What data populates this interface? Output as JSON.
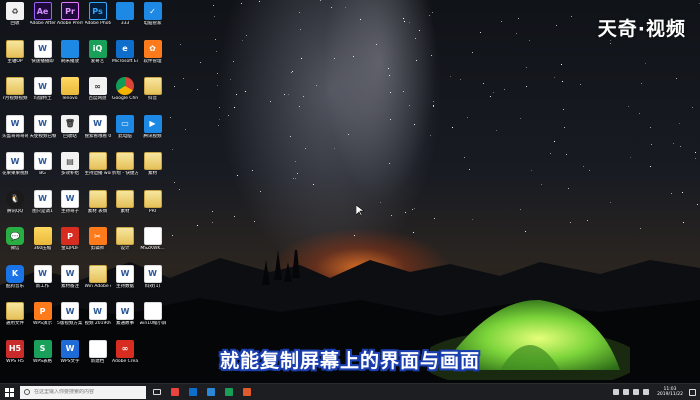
{
  "watermark": "天奇·视频",
  "subtitle": "就能复制屏幕上的界面与画面",
  "desktop_icons": [
    {
      "label": "回收",
      "icon": "recycle-bin-icon",
      "kind": "c-white",
      "glyph": "♻",
      "col": 0,
      "row": 0
    },
    {
      "label": "Adobe After Effects CC",
      "icon": "after-effects-icon",
      "kind": "c-ae",
      "glyph": "Ae",
      "col": 1,
      "row": 0
    },
    {
      "label": "Adobe Premiere P...",
      "icon": "premiere-icon",
      "kind": "c-pr",
      "glyph": "Pr",
      "col": 2,
      "row": 0
    },
    {
      "label": "Adobe Photosh...",
      "icon": "photoshop-icon",
      "kind": "c-ps",
      "glyph": "Ps",
      "col": 3,
      "row": 0
    },
    {
      "label": "333",
      "icon": "folder-icon",
      "kind": "c-blue",
      "glyph": "",
      "col": 4,
      "row": 0
    },
    {
      "label": "电脑管家",
      "icon": "security-manager-icon",
      "kind": "c-blue",
      "glyph": "✓",
      "col": 5,
      "row": 0
    },
    {
      "label": "主轴OP",
      "icon": "file-icon",
      "kind": "c-file",
      "glyph": "",
      "col": 0,
      "row": 1
    },
    {
      "label": "快速播播即",
      "icon": "document-icon",
      "kind": "c-doc",
      "glyph": "W",
      "col": 1,
      "row": 1
    },
    {
      "label": "刷米播放",
      "icon": "image-icon",
      "kind": "c-blue",
      "glyph": "",
      "col": 2,
      "row": 1
    },
    {
      "label": "爱奇艺",
      "icon": "iqiyi-icon",
      "kind": "c-green",
      "glyph": "iQ",
      "col": 3,
      "row": 1
    },
    {
      "label": "Microsoft Edge",
      "icon": "edge-icon",
      "kind": "c-edge",
      "glyph": "e",
      "col": 4,
      "row": 1
    },
    {
      "label": "软件管理",
      "icon": "software-manager-icon",
      "kind": "c-orange",
      "glyph": "✿",
      "col": 5,
      "row": 1
    },
    {
      "label": "7月视频视频子",
      "icon": "file-icon",
      "kind": "c-file",
      "glyph": "",
      "col": 0,
      "row": 2
    },
    {
      "label": "玛伽特土",
      "icon": "document-icon",
      "kind": "c-doc",
      "glyph": "W",
      "col": 1,
      "row": 2
    },
    {
      "label": "lenovo",
      "icon": "folder-icon",
      "kind": "c-folder",
      "glyph": "",
      "col": 2,
      "row": 2
    },
    {
      "label": "百度网盘",
      "icon": "baidu-netdisk-icon",
      "kind": "c-white",
      "glyph": "∞",
      "col": 3,
      "row": 2
    },
    {
      "label": "Google Chrome",
      "icon": "chrome-icon",
      "kind": "c-chrome",
      "glyph": "",
      "col": 4,
      "row": 2
    },
    {
      "label": "抖音",
      "icon": "file-icon",
      "kind": "c-file",
      "glyph": "",
      "col": 5,
      "row": 2
    },
    {
      "label": "头盔哥哥哥哥功能版",
      "icon": "document-icon",
      "kind": "c-doc",
      "glyph": "W",
      "col": 0,
      "row": 3
    },
    {
      "label": "天使视频已帧帧子",
      "icon": "document-icon",
      "kind": "c-doc",
      "glyph": "W",
      "col": 1,
      "row": 3
    },
    {
      "label": "回收站",
      "icon": "recycle-bin-icon",
      "kind": "c-white",
      "glyph": "🗑",
      "col": 2,
      "row": 3
    },
    {
      "label": "搜索看哦看 07.09.05...",
      "icon": "document-icon",
      "kind": "c-doc",
      "glyph": "W",
      "col": 3,
      "row": 3
    },
    {
      "label": "此电脑",
      "icon": "computer-icon",
      "kind": "c-blue",
      "glyph": "▭",
      "col": 4,
      "row": 3
    },
    {
      "label": "腾讯视频",
      "icon": "tencent-video-icon",
      "kind": "c-blue",
      "glyph": "▶",
      "col": 5,
      "row": 3
    },
    {
      "label": "花果果果视频方案视频子07.08",
      "icon": "document-icon",
      "kind": "c-doc",
      "glyph": "W",
      "col": 0,
      "row": 4
    },
    {
      "label": "BG",
      "icon": "document-icon",
      "kind": "c-doc",
      "glyph": "W",
      "col": 1,
      "row": 4
    },
    {
      "label": "多效补给",
      "icon": "zip-icon",
      "kind": "c-white",
      "glyph": "▤",
      "col": 2,
      "row": 4
    },
    {
      "label": "主持边播 word用哥子",
      "icon": "file-icon",
      "kind": "c-file",
      "glyph": "",
      "col": 3,
      "row": 4
    },
    {
      "label": "折绘 - 快捷方式",
      "icon": "file-icon",
      "kind": "c-file",
      "glyph": "",
      "col": 4,
      "row": 4
    },
    {
      "label": "素材",
      "icon": "file-icon",
      "kind": "c-file",
      "glyph": "",
      "col": 5,
      "row": 4
    },
    {
      "label": "腾讯QQ",
      "icon": "qq-icon",
      "kind": "c-qq",
      "glyph": "🐧",
      "col": 0,
      "row": 5
    },
    {
      "label": "图只是调1",
      "icon": "document-icon",
      "kind": "c-doc",
      "glyph": "W",
      "col": 1,
      "row": 5
    },
    {
      "label": "主持哥子",
      "icon": "document-icon",
      "kind": "c-doc",
      "glyph": "W",
      "col": 2,
      "row": 5
    },
    {
      "label": "素材 表情",
      "icon": "file-icon",
      "kind": "c-file",
      "glyph": "",
      "col": 3,
      "row": 5
    },
    {
      "label": "素材",
      "icon": "file-icon",
      "kind": "c-file",
      "glyph": "",
      "col": 4,
      "row": 5
    },
    {
      "label": "PRI",
      "icon": "file-icon",
      "kind": "c-file",
      "glyph": "",
      "col": 5,
      "row": 5
    },
    {
      "label": "微信",
      "icon": "wechat-icon",
      "kind": "c-wechat",
      "glyph": "💬",
      "col": 0,
      "row": 6
    },
    {
      "label": "360压缩",
      "icon": "folder-icon",
      "kind": "c-folder",
      "glyph": "",
      "col": 1,
      "row": 6
    },
    {
      "label": "金山PDF",
      "icon": "pdf-icon",
      "kind": "c-red",
      "glyph": "P",
      "col": 2,
      "row": 6
    },
    {
      "label": "剪辑师",
      "icon": "scissors-icon",
      "kind": "c-orange",
      "glyph": "✂",
      "col": 3,
      "row": 6
    },
    {
      "label": "设计",
      "icon": "file-icon",
      "kind": "c-file",
      "glyph": "",
      "col": 4,
      "row": 6
    },
    {
      "label": "MSZKWK...",
      "icon": "document-icon",
      "kind": "c-doc",
      "glyph": "",
      "col": 5,
      "row": 6
    },
    {
      "label": "酷狗音乐",
      "icon": "kugou-icon",
      "kind": "c-kugou",
      "glyph": "K",
      "col": 0,
      "row": 7
    },
    {
      "label": "新工作",
      "icon": "document-icon",
      "kind": "c-doc",
      "glyph": "W",
      "col": 1,
      "row": 7
    },
    {
      "label": "素材备注",
      "icon": "document-icon",
      "kind": "c-doc",
      "glyph": "W",
      "col": 2,
      "row": 7
    },
    {
      "label": "Win Adobe cc 2018 注...",
      "icon": "file-icon",
      "kind": "c-file",
      "glyph": "",
      "col": 3,
      "row": 7
    },
    {
      "label": "主持数据",
      "icon": "document-icon",
      "kind": "c-doc",
      "glyph": "W",
      "col": 4,
      "row": 7
    },
    {
      "label": "料效(1)",
      "icon": "document-icon",
      "kind": "c-doc",
      "glyph": "W",
      "col": 5,
      "row": 7
    },
    {
      "label": "通用文件",
      "icon": "file-icon",
      "kind": "c-file",
      "glyph": "",
      "col": 0,
      "row": 8
    },
    {
      "label": "WPS演示",
      "icon": "wps-presentation-icon",
      "kind": "c-orange",
      "glyph": "P",
      "col": 1,
      "row": 8
    },
    {
      "label": "5版视频方案 音字剧集...",
      "icon": "document-icon",
      "kind": "c-doc",
      "glyph": "W",
      "col": 2,
      "row": 8
    },
    {
      "label": "视频 2019091...",
      "icon": "document-icon",
      "kind": "c-doc",
      "glyph": "W",
      "col": 3,
      "row": 8
    },
    {
      "label": "素通故事",
      "icon": "document-icon",
      "kind": "c-doc",
      "glyph": "W",
      "col": 4,
      "row": 8
    },
    {
      "label": "win10缩小屏 选择",
      "icon": "document-icon",
      "kind": "c-doc",
      "glyph": "",
      "col": 5,
      "row": 8
    },
    {
      "label": "WPS H5",
      "icon": "wps-h5-icon",
      "kind": "c-wps-red",
      "glyph": "H5",
      "col": 0,
      "row": 9
    },
    {
      "label": "WPS表格",
      "icon": "wps-spreadsheet-icon",
      "kind": "c-wps-green",
      "glyph": "S",
      "col": 1,
      "row": 9
    },
    {
      "label": "WPS文字",
      "icon": "wps-writer-icon",
      "kind": "c-wps-blue",
      "glyph": "W",
      "col": 2,
      "row": 9
    },
    {
      "label": "新建档",
      "icon": "document-icon",
      "kind": "c-doc",
      "glyph": "",
      "col": 3,
      "row": 9
    },
    {
      "label": "Adobe Creati...",
      "icon": "creative-cloud-icon",
      "kind": "c-red",
      "glyph": "∞",
      "col": 4,
      "row": 9
    }
  ],
  "taskbar": {
    "search_placeholder": "在这里输入你要搜索的内容",
    "pinned_apps": [
      {
        "name": "chrome-taskbar-icon",
        "color": "#e8453c"
      },
      {
        "name": "edge-taskbar-icon",
        "color": "#0f6ecb"
      },
      {
        "name": "store-taskbar-icon",
        "color": "#2b88d8"
      },
      {
        "name": "iqiyi-taskbar-icon",
        "color": "#18a058"
      },
      {
        "name": "app-taskbar-icon",
        "color": "#e05a2c"
      }
    ],
    "clock_time": "11:03",
    "clock_date": "2019/11/22"
  },
  "colors": {
    "subtitle_outline": "#1b3fae",
    "taskbar_bg": "#1c1e22",
    "tent": "#7bd43a"
  }
}
